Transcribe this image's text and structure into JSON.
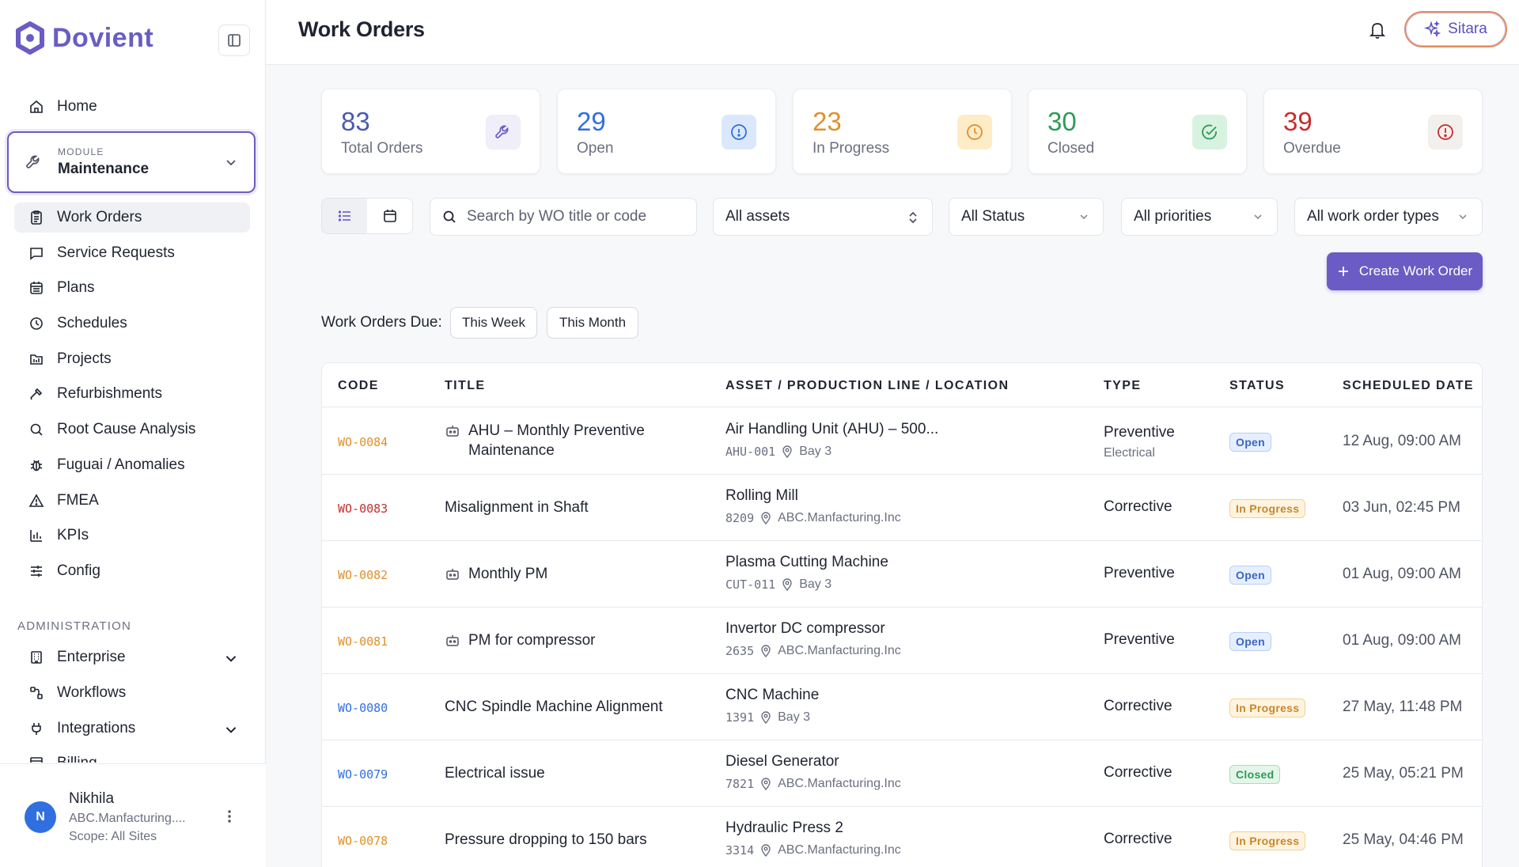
{
  "brand": {
    "name": "Dovient",
    "color": "#6a5cc4"
  },
  "sidebar": {
    "module_caption": "MODULE",
    "module_value": "Maintenance",
    "items": [
      {
        "label": "Home",
        "icon": "home-icon"
      },
      {
        "label": "Work Orders",
        "icon": "clipboard-icon",
        "active": true
      },
      {
        "label": "Service Requests",
        "icon": "message-icon"
      },
      {
        "label": "Plans",
        "icon": "calendar-icon"
      },
      {
        "label": "Schedules",
        "icon": "clock-icon"
      },
      {
        "label": "Projects",
        "icon": "folder-icon"
      },
      {
        "label": "Refurbishments",
        "icon": "hammer-icon"
      },
      {
        "label": "Root Cause Analysis",
        "icon": "search-icon"
      },
      {
        "label": "Fuguai / Anomalies",
        "icon": "bug-icon"
      },
      {
        "label": "FMEA",
        "icon": "warning-icon"
      },
      {
        "label": "KPIs",
        "icon": "bar-chart-icon"
      },
      {
        "label": "Config",
        "icon": "sliders-icon"
      }
    ],
    "admin_label": "ADMINISTRATION",
    "admin_items": [
      {
        "label": "Enterprise",
        "icon": "building-icon",
        "expandable": true
      },
      {
        "label": "Workflows",
        "icon": "workflow-icon"
      },
      {
        "label": "Integrations",
        "icon": "plug-icon",
        "expandable": true
      },
      {
        "label": "Billing",
        "icon": "billing-icon"
      }
    ],
    "user": {
      "initial": "N",
      "name": "Nikhila",
      "org": "ABC.Manfacturing....",
      "scope": "Scope: All Sites"
    }
  },
  "header": {
    "title": "Work Orders",
    "assistant_label": "Sitara"
  },
  "stats": [
    {
      "value": "83",
      "label": "Total Orders",
      "color": "#4a5bb0",
      "icon": "wrench-icon",
      "icon_bg": "#efeef9",
      "icon_color": "#6a5cc4"
    },
    {
      "value": "29",
      "label": "Open",
      "color": "#2f6fe0",
      "icon": "info-circle-icon",
      "icon_bg": "#dbe8fb",
      "icon_color": "#2f6fe0"
    },
    {
      "value": "23",
      "label": "In Progress",
      "color": "#e0902a",
      "icon": "clock-icon",
      "icon_bg": "#fdecc6",
      "icon_color": "#e0902a"
    },
    {
      "value": "30",
      "label": "Closed",
      "color": "#2f9a58",
      "icon": "check-circle-icon",
      "icon_bg": "#d8f2e1",
      "icon_color": "#2f9a58"
    },
    {
      "value": "39",
      "label": "Overdue",
      "color": "#c62d2d",
      "icon": "alert-circle-icon",
      "icon_bg": "#f3efec",
      "icon_color": "#c62d2d"
    }
  ],
  "filters": {
    "search_placeholder": "Search by WO title or code",
    "assets": "All assets",
    "status": "All Status",
    "priorities": "All priorities",
    "types": "All work order types"
  },
  "create_label": "Create Work Order",
  "due": {
    "label": "Work Orders Due:",
    "this_week": "This Week",
    "this_month": "This Month"
  },
  "table": {
    "headers": [
      "CODE",
      "TITLE",
      "ASSET / PRODUCTION LINE / LOCATION",
      "TYPE",
      "STATUS",
      "SCHEDULED DATE"
    ],
    "rows": [
      {
        "code": "WO-0084",
        "code_color": "#e0902a",
        "title": "AHU – Monthly Preventive Maintenance",
        "pm": true,
        "asset": "Air Handling Unit (AHU) – 500...",
        "asset_code": "AHU-001",
        "location": "Bay 3",
        "type": "Preventive",
        "type_sub": "Electrical",
        "status": "Open",
        "status_kind": "open",
        "date": "12 Aug, 09:00 AM"
      },
      {
        "code": "WO-0083",
        "code_color": "#c62d2d",
        "title": "Misalignment in Shaft",
        "pm": false,
        "asset": "Rolling Mill",
        "asset_code": "8209",
        "location": "ABC.Manfacturing.Inc",
        "type": "Corrective",
        "type_sub": "",
        "status": "In Progress",
        "status_kind": "prog",
        "date": "03 Jun, 02:45 PM"
      },
      {
        "code": "WO-0082",
        "code_color": "#e0902a",
        "title": "Monthly PM",
        "pm": true,
        "asset": "Plasma Cutting Machine",
        "asset_code": "CUT-011",
        "location": "Bay 3",
        "type": "Preventive",
        "type_sub": "",
        "status": "Open",
        "status_kind": "open",
        "date": "01 Aug, 09:00 AM"
      },
      {
        "code": "WO-0081",
        "code_color": "#e0902a",
        "title": "PM for compressor",
        "pm": true,
        "asset": "Invertor DC compressor",
        "asset_code": "2635",
        "location": "ABC.Manfacturing.Inc",
        "type": "Preventive",
        "type_sub": "",
        "status": "Open",
        "status_kind": "open",
        "date": "01 Aug, 09:00 AM"
      },
      {
        "code": "WO-0080",
        "code_color": "#2f6fe0",
        "title": "CNC Spindle Machine Alignment",
        "pm": false,
        "asset": "CNC Machine",
        "asset_code": "1391",
        "location": "Bay 3",
        "type": "Corrective",
        "type_sub": "",
        "status": "In Progress",
        "status_kind": "prog",
        "date": "27 May, 11:48 PM"
      },
      {
        "code": "WO-0079",
        "code_color": "#2f6fe0",
        "title": "Electrical issue",
        "pm": false,
        "asset": "Diesel Generator",
        "asset_code": "7821",
        "location": "ABC.Manfacturing.Inc",
        "type": "Corrective",
        "type_sub": "",
        "status": "Closed",
        "status_kind": "closed",
        "date": "25 May, 05:21 PM"
      },
      {
        "code": "WO-0078",
        "code_color": "#e0902a",
        "title": "Pressure dropping to 150 bars",
        "pm": false,
        "asset": "Hydraulic Press 2",
        "asset_code": "3314",
        "location": "ABC.Manfacturing.Inc",
        "type": "Corrective",
        "type_sub": "",
        "status": "In Progress",
        "status_kind": "prog",
        "date": "25 May, 04:46 PM"
      }
    ]
  }
}
